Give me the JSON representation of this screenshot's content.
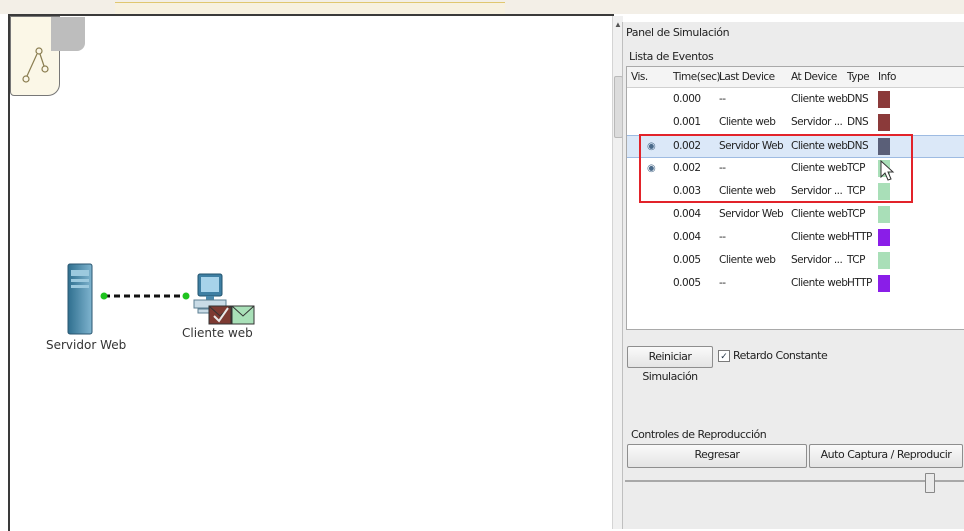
{
  "simulation_panel": {
    "title": "Panel de Simulación",
    "event_list_title": "Lista de Eventos",
    "columns": [
      "Vis.",
      "Time(sec)",
      "Last Device",
      "At Device",
      "Type",
      "Info"
    ],
    "events": [
      {
        "vis": "",
        "time": "0.000",
        "last_device": "--",
        "at_device": "Cliente web",
        "type": "DNS",
        "color": "#8b3a3a"
      },
      {
        "vis": "",
        "time": "0.001",
        "last_device": "Cliente web",
        "at_device": "Servidor ...",
        "type": "DNS",
        "color": "#8b3a3a"
      },
      {
        "vis": "eye",
        "time": "0.002",
        "last_device": "Servidor Web",
        "at_device": "Cliente web",
        "type": "DNS",
        "color": "#5a5f78"
      },
      {
        "vis": "eye",
        "time": "0.002",
        "last_device": "--",
        "at_device": "Cliente web",
        "type": "TCP",
        "color": "#a9dfb8"
      },
      {
        "vis": "",
        "time": "0.003",
        "last_device": "Cliente web",
        "at_device": "Servidor ...",
        "type": "TCP",
        "color": "#a9dfb8"
      },
      {
        "vis": "",
        "time": "0.004",
        "last_device": "Servidor Web",
        "at_device": "Cliente web",
        "type": "TCP",
        "color": "#a9dfb8"
      },
      {
        "vis": "",
        "time": "0.004",
        "last_device": "--",
        "at_device": "Cliente web",
        "type": "HTTP",
        "color": "#8a1ee8"
      },
      {
        "vis": "",
        "time": "0.005",
        "last_device": "Cliente web",
        "at_device": "Servidor ...",
        "type": "TCP",
        "color": "#a9dfb8"
      },
      {
        "vis": "",
        "time": "0.005",
        "last_device": "--",
        "at_device": "Cliente web",
        "type": "HTTP",
        "color": "#8a1ee8"
      }
    ],
    "reset_button": "Reiniciar Simulación",
    "constant_delay_label": "Retardo Constante",
    "constant_delay_checked": true,
    "playback_title": "Controles de Reproducción",
    "back_button": "Regresar",
    "auto_capture_button": "Auto Captura / Reproducir"
  },
  "topology": {
    "server_label": "Servidor Web",
    "client_label": "Cliente web"
  }
}
